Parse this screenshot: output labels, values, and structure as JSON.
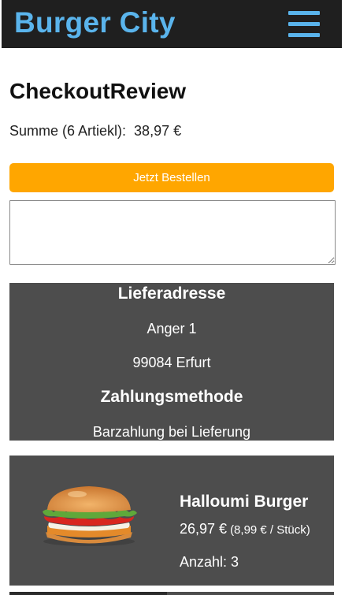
{
  "header": {
    "brand": "Burger City",
    "menu_icon": "hamburger-menu-icon"
  },
  "checkout": {
    "title": "CheckoutReview",
    "summary_label": "Summe (6 Artiekl):",
    "summary_amount": "38,97 €",
    "order_button_label": "Jetzt Bestellen",
    "note_value": "",
    "note_placeholder": ""
  },
  "delivery": {
    "address_heading": "Lieferadresse",
    "street": "Anger 1",
    "city": "99084 Erfurt",
    "payment_heading": "Zahlungsmethode",
    "payment_method": "Barzahlung bei Lieferung"
  },
  "cart_items": [
    {
      "name": "Halloumi Burger",
      "total_price": "26,97 €",
      "unit_price": "(8,99 € / Stück)",
      "quantity_label": "Anzahl: 3",
      "image_icon": "burger-image"
    }
  ],
  "colors": {
    "navbar_bg": "#1f1f1f",
    "brand": "#5ab4ec",
    "order_button": "#ffa600",
    "card_bg": "#4d4d4d"
  }
}
